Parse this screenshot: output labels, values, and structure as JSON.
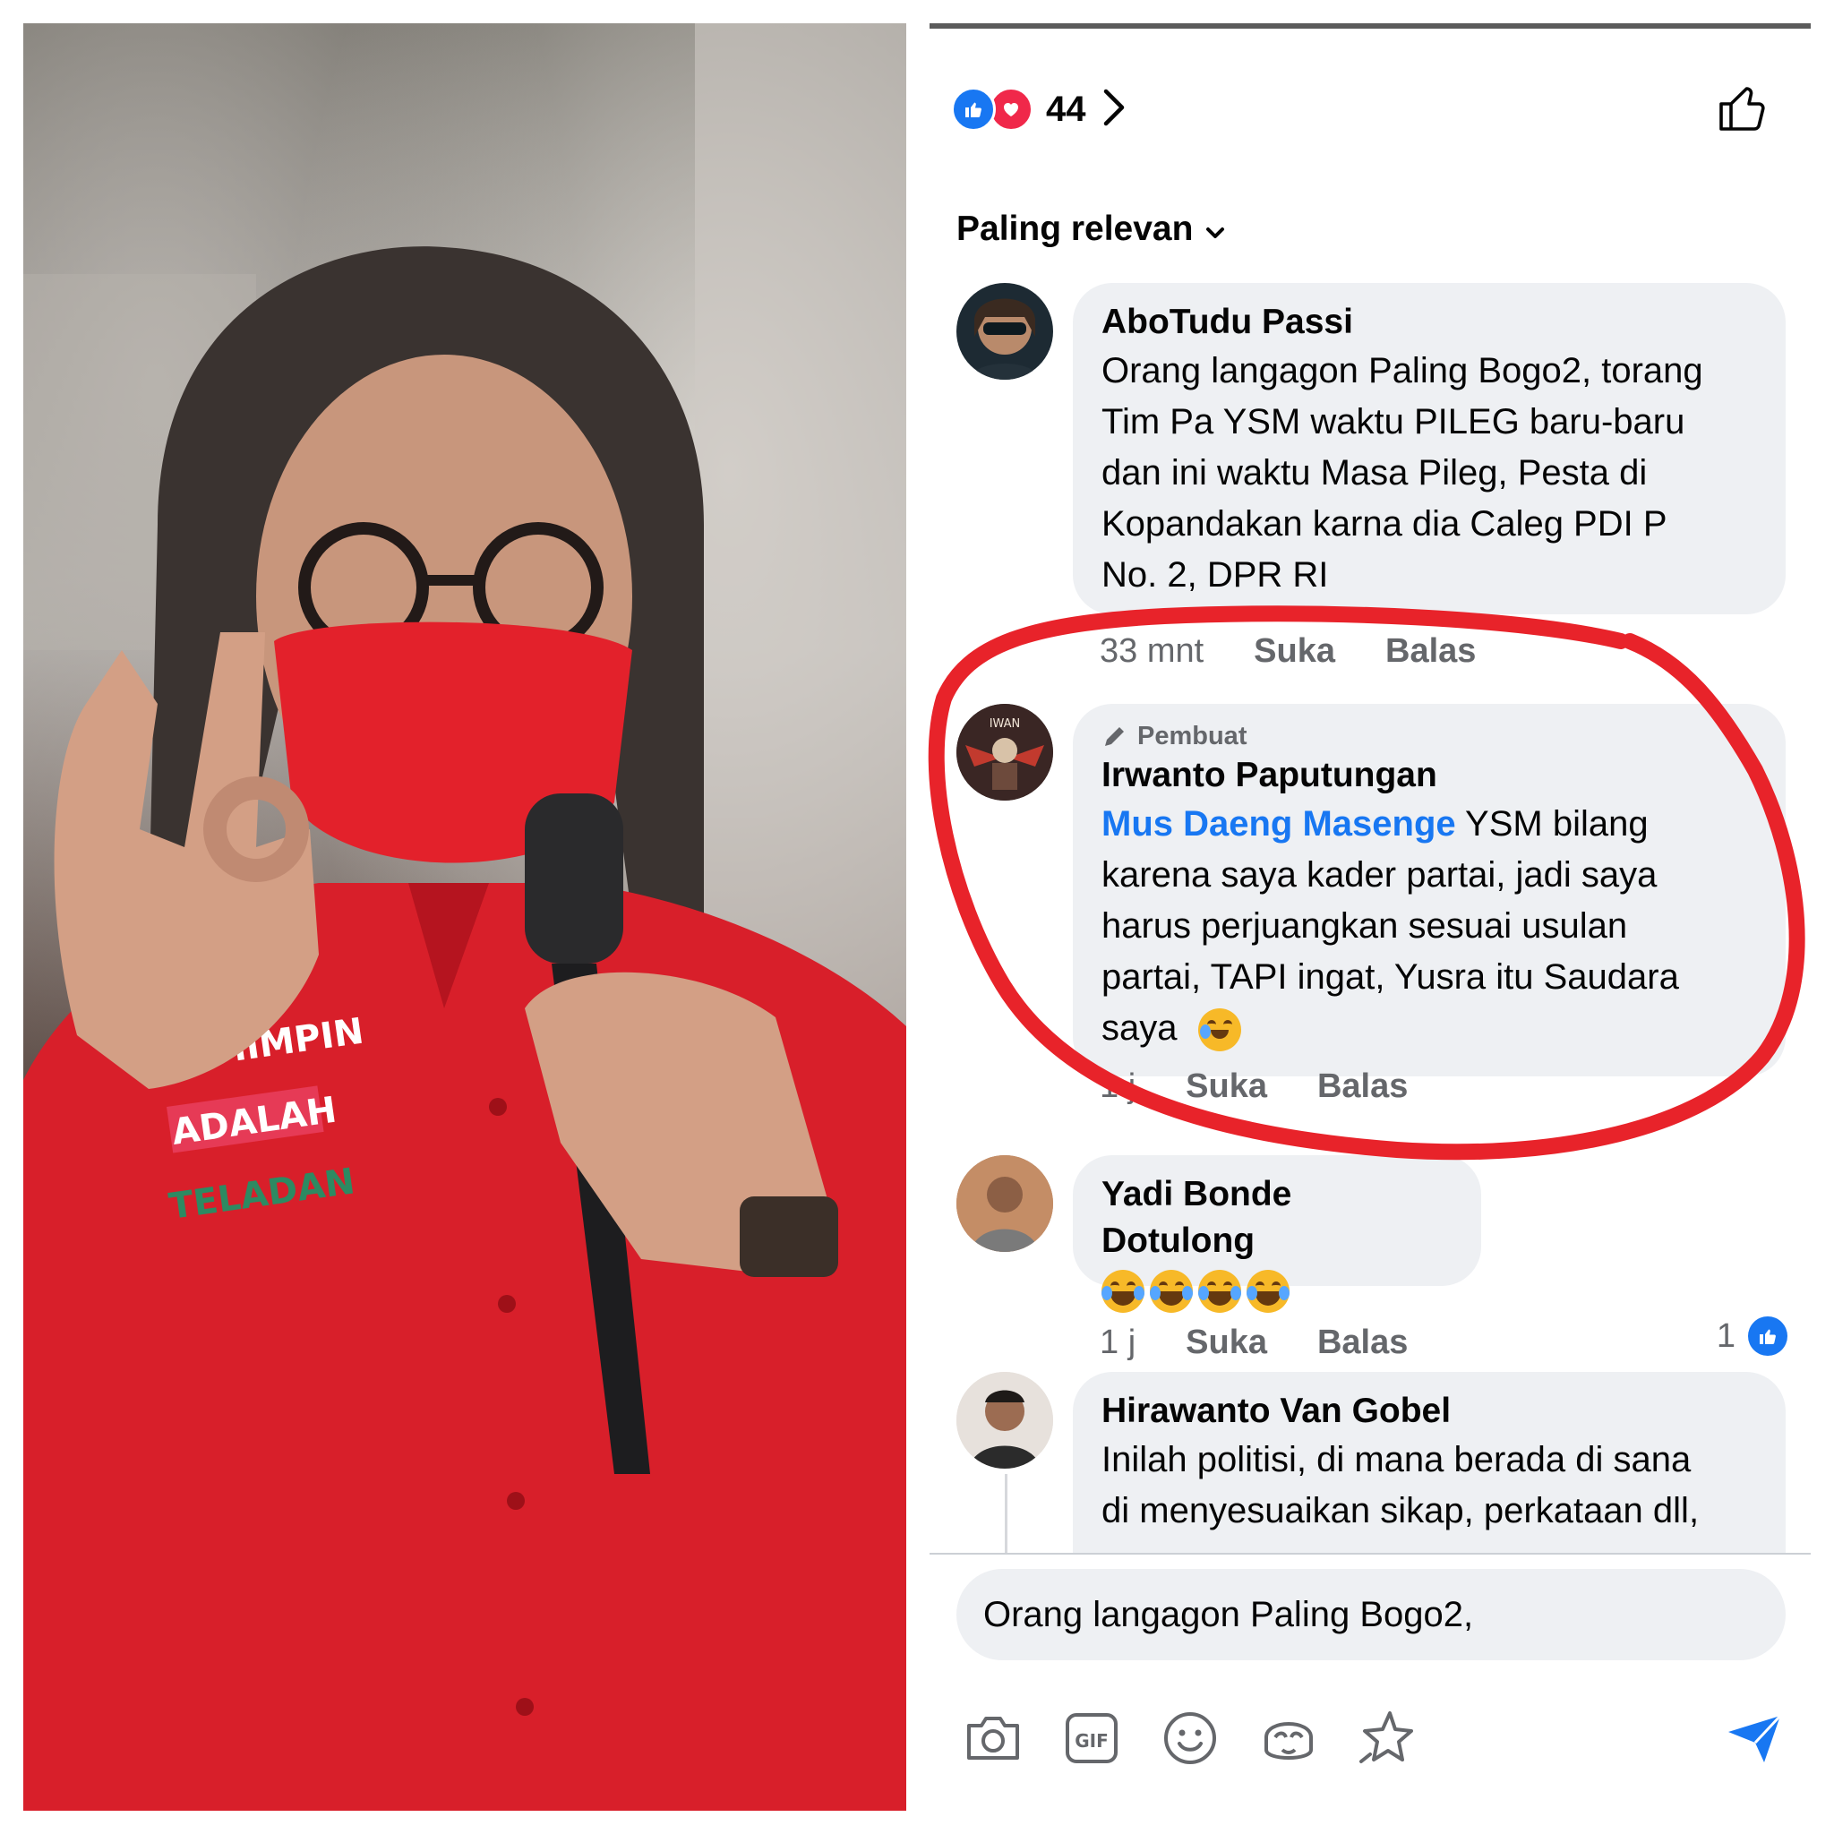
{
  "reactions": {
    "count": "44"
  },
  "sort": {
    "label": "Paling relevan"
  },
  "comments": [
    {
      "author": "AboTudu Passi",
      "lines": [
        "Orang langagon Paling Bogo2, torang",
        "Tim Pa YSM waktu PILEG baru-baru",
        "dan ini waktu Masa Pileg, Pesta di",
        "Kopandakan  karna dia Caleg PDI P",
        "No. 2, DPR RI"
      ],
      "time": "33 mnt",
      "like_label": "Suka",
      "reply_label": "Balas"
    },
    {
      "badge": "Pembuat",
      "author": "Irwanto Paputungan",
      "mention": "Mus Daeng Masenge",
      "first_line_rest": " YSM bilang",
      "lines": [
        "karena saya kader partai, jadi saya",
        "harus perjuangkan sesuai usulan",
        "partai, TAPI ingat, Yusra itu Saudara",
        "saya"
      ],
      "time": "1 j",
      "like_label": "Suka",
      "reply_label": "Balas"
    },
    {
      "author": "Yadi Bonde Dotulong",
      "emoji": "laughing-tears x4",
      "time": "1 j",
      "like_label": "Suka",
      "reply_label": "Balas",
      "likes": "1"
    },
    {
      "author": "Hirawanto Van Gobel",
      "lines": [
        "Inilah politisi, di mana berada di sana",
        "di menyesuaikan sikap, perkataan dll,"
      ]
    }
  ],
  "composer": {
    "value": "Orang langagon Paling Bogo2,"
  },
  "colors": {
    "accent": "#1877f2",
    "annotation": "#e8232a",
    "bubble": "#eef0f3"
  },
  "icons": [
    "camera-icon",
    "gif-icon",
    "emoji-icon",
    "avatar-sticker-icon",
    "sparkle-icon",
    "send-icon"
  ]
}
